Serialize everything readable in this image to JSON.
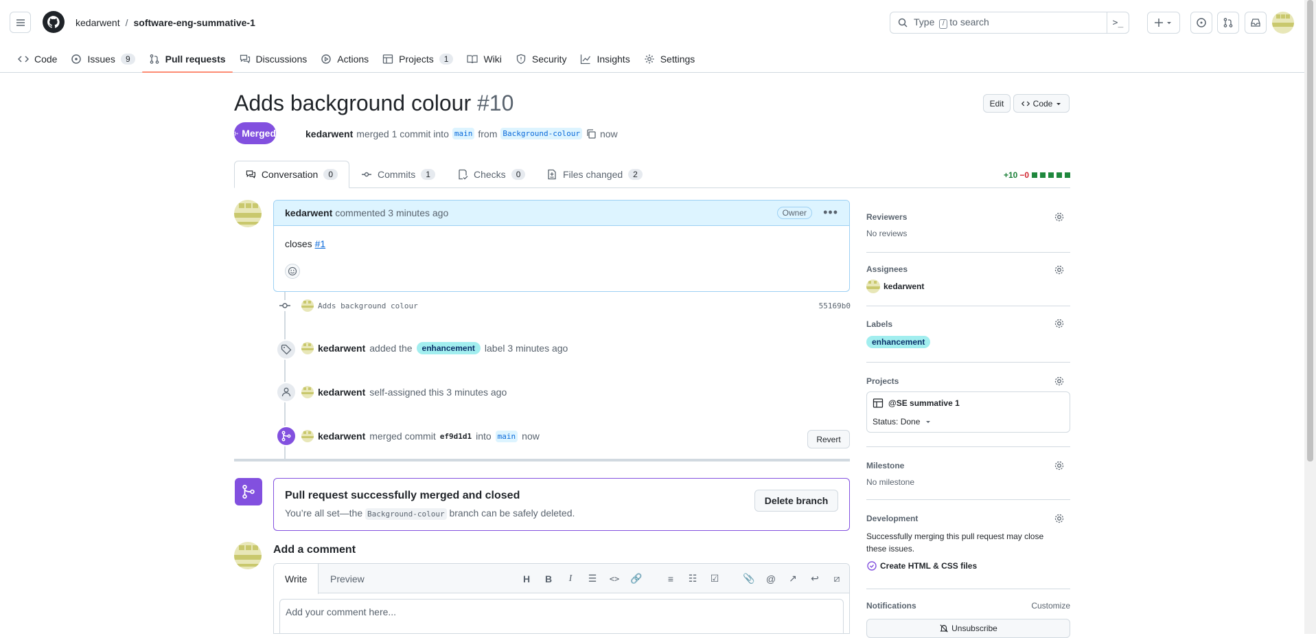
{
  "header": {
    "owner": "kedarwent",
    "separator": "/",
    "repo": "software-eng-summative-1",
    "search_placeholder_pre": "Type",
    "search_key": "/",
    "search_placeholder_post": "to search",
    "command_glyph": ">_"
  },
  "nav": [
    {
      "label": "Code",
      "icon": "code-icon"
    },
    {
      "label": "Issues",
      "count": "9",
      "icon": "issue-icon"
    },
    {
      "label": "Pull requests",
      "icon": "pull-request-icon",
      "selected": true
    },
    {
      "label": "Discussions",
      "icon": "discussion-icon"
    },
    {
      "label": "Actions",
      "icon": "play-icon"
    },
    {
      "label": "Projects",
      "count": "1",
      "icon": "table-icon"
    },
    {
      "label": "Wiki",
      "icon": "book-icon"
    },
    {
      "label": "Security",
      "icon": "shield-icon"
    },
    {
      "label": "Insights",
      "icon": "graph-icon"
    },
    {
      "label": "Settings",
      "icon": "gear-icon"
    }
  ],
  "pr": {
    "title": "Adds background colour",
    "number": "#10",
    "edit_label": "Edit",
    "code_label": "Code",
    "state": "Merged",
    "author": "kedarwent",
    "merge_text": "merged 1 commit into",
    "base": "main",
    "from_text": "from",
    "head": "Background-colour",
    "time": "now"
  },
  "tabs": [
    {
      "label": "Conversation",
      "count": "0"
    },
    {
      "label": "Commits",
      "count": "1"
    },
    {
      "label": "Checks",
      "count": "0"
    },
    {
      "label": "Files changed",
      "count": "2"
    }
  ],
  "diffstat": {
    "additions": "+10",
    "deletions": "−0"
  },
  "comment": {
    "author": "kedarwent",
    "action": "commented 3 minutes ago",
    "role": "Owner",
    "body_prefix": "closes",
    "body_link": "#1"
  },
  "timeline": {
    "commit_msg": "Adds background colour",
    "commit_sha": "55169b0",
    "label_actor": "kedarwent",
    "label_pre": "added the",
    "label_name": "enhancement",
    "label_post": "label 3 minutes ago",
    "assign_actor": "kedarwent",
    "assign_text": "self-assigned this 3 minutes ago",
    "merge_actor": "kedarwent",
    "merge_pre": "merged commit",
    "merge_sha": "ef9d1d1",
    "merge_into": "into",
    "merge_base": "main",
    "merge_time": "now",
    "revert_label": "Revert"
  },
  "merged_card": {
    "heading": "Pull request successfully merged and closed",
    "sub_pre": "You’re all set—the",
    "branch": "Background-colour",
    "sub_post": "branch can be safely deleted.",
    "delete_label": "Delete branch"
  },
  "add_comment": {
    "title": "Add a comment",
    "write_tab": "Write",
    "preview_tab": "Preview",
    "placeholder": "Add your comment here..."
  },
  "sidebar": {
    "reviewers_title": "Reviewers",
    "reviewers_value": "No reviews",
    "assignees_title": "Assignees",
    "assignee": "kedarwent",
    "labels_title": "Labels",
    "label": "enhancement",
    "projects_title": "Projects",
    "project_name": "@SE summative 1",
    "project_status": "Status: Done",
    "milestone_title": "Milestone",
    "milestone_value": "No milestone",
    "development_title": "Development",
    "development_text": "Successfully merging this pull request may close these issues.",
    "linked_issue": "Create HTML & CSS files",
    "notifications_title": "Notifications",
    "customize": "Customize",
    "unsubscribe": "Unsubscribe"
  },
  "colors": {
    "merged": "#8250df",
    "accent": "#0969da",
    "label": "#a2eeef",
    "nav_underline": "#fd8c73"
  }
}
